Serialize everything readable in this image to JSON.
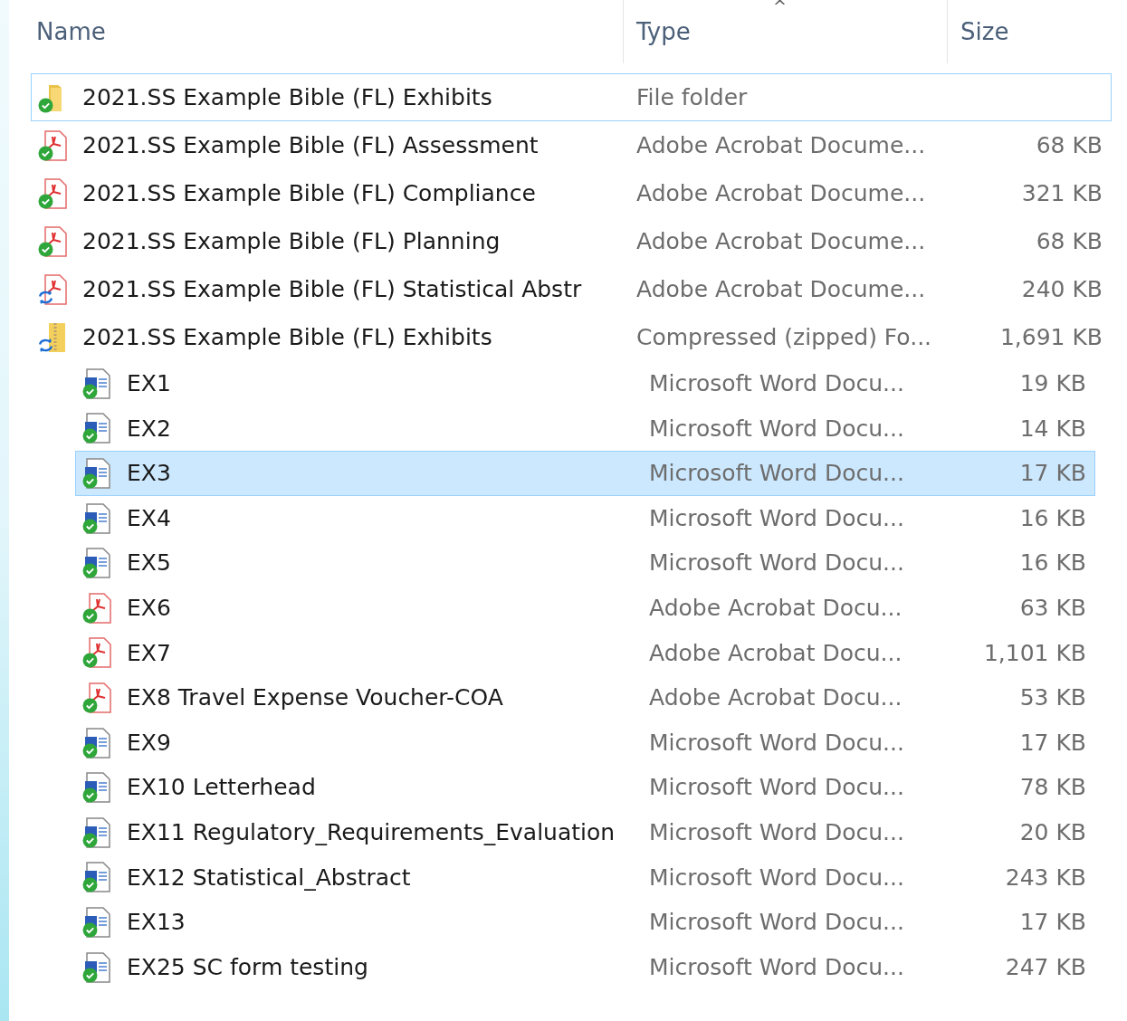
{
  "columns": [
    {
      "label": "Name",
      "sorted": false
    },
    {
      "label": "Type",
      "sorted": true
    },
    {
      "label": "Size",
      "sorted": false
    }
  ],
  "sort_indicator": "^",
  "items": [
    {
      "name": "2021.SS Example Bible (FL) Exhibits",
      "type": "File folder",
      "kind": "folder",
      "synced": true,
      "selected": false,
      "focused": true
    },
    {
      "name": "2021.SS Example Bible (FL) Assessment",
      "type": "Adobe Acrobat Docume...",
      "size": "68 KB",
      "kind": "pdf",
      "synced": true,
      "selected": false,
      "focused": false
    },
    {
      "name": "2021.SS Example Bible (FL) Compliance",
      "type": "Adobe Acrobat Docume...",
      "size": "321 KB",
      "kind": "pdf",
      "synced": true,
      "selected": false,
      "focused": false
    },
    {
      "name": "2021.SS Example Bible (FL) Planning",
      "type": "Adobe Acrobat Docume...",
      "size": "68 KB",
      "kind": "pdf",
      "synced": true,
      "selected": false,
      "focused": false
    },
    {
      "name": "2021.SS Example Bible (FL) Statistical Abstr",
      "type": "Adobe Acrobat Docume...",
      "size": "240 KB",
      "kind": "pdf",
      "synced": false,
      "selected": false,
      "focused": false
    },
    {
      "name": "2021.SS Example Bible (FL) Exhibits",
      "type": "Compressed (zipped) Fo...",
      "size": "1,691 KB",
      "kind": "zip",
      "synced": false,
      "selected": false,
      "focused": false,
      "children": [
        {
          "name": "EX1",
          "type": "Microsoft Word Docu...",
          "size": "19 KB",
          "kind": "word",
          "synced": true,
          "selected": false
        },
        {
          "name": "EX2",
          "type": "Microsoft Word Docu...",
          "size": "14 KB",
          "kind": "word",
          "synced": true,
          "selected": false
        },
        {
          "name": "EX3",
          "type": "Microsoft Word Docu...",
          "size": "17 KB",
          "kind": "word",
          "synced": true,
          "selected": true
        },
        {
          "name": "EX4",
          "type": "Microsoft Word Docu...",
          "size": "16 KB",
          "kind": "word",
          "synced": true,
          "selected": false
        },
        {
          "name": "EX5",
          "type": "Microsoft Word Docu...",
          "size": "16 KB",
          "kind": "word",
          "synced": true,
          "selected": false
        },
        {
          "name": "EX6",
          "type": "Adobe Acrobat Docu...",
          "size": "63 KB",
          "kind": "pdf",
          "synced": true,
          "selected": false
        },
        {
          "name": "EX7",
          "type": "Adobe Acrobat Docu...",
          "size": "1,101 KB",
          "kind": "pdf",
          "synced": true,
          "selected": false
        },
        {
          "name": "EX8 Travel Expense Voucher-COA",
          "type": "Adobe Acrobat Docu...",
          "size": "53 KB",
          "kind": "pdf",
          "synced": true,
          "selected": false
        },
        {
          "name": "EX9",
          "type": "Microsoft Word Docu...",
          "size": "17 KB",
          "kind": "word",
          "synced": true,
          "selected": false
        },
        {
          "name": "EX10 Letterhead",
          "type": "Microsoft Word Docu...",
          "size": "78 KB",
          "kind": "word",
          "synced": true,
          "selected": false
        },
        {
          "name": "EX11 Regulatory_Requirements_Evaluation",
          "type": "Microsoft Word Docu...",
          "size": "20 KB",
          "kind": "word",
          "synced": true,
          "selected": false
        },
        {
          "name": "EX12 Statistical_Abstract",
          "type": "Microsoft Word Docu...",
          "size": "243 KB",
          "kind": "word",
          "synced": true,
          "selected": false
        },
        {
          "name": "EX13",
          "type": "Microsoft Word Docu...",
          "size": "17 KB",
          "kind": "word",
          "synced": true,
          "selected": false
        },
        {
          "name": "EX25 SC form testing",
          "type": "Microsoft Word Docu...",
          "size": "247 KB",
          "kind": "word",
          "synced": true,
          "selected": false
        }
      ]
    }
  ]
}
